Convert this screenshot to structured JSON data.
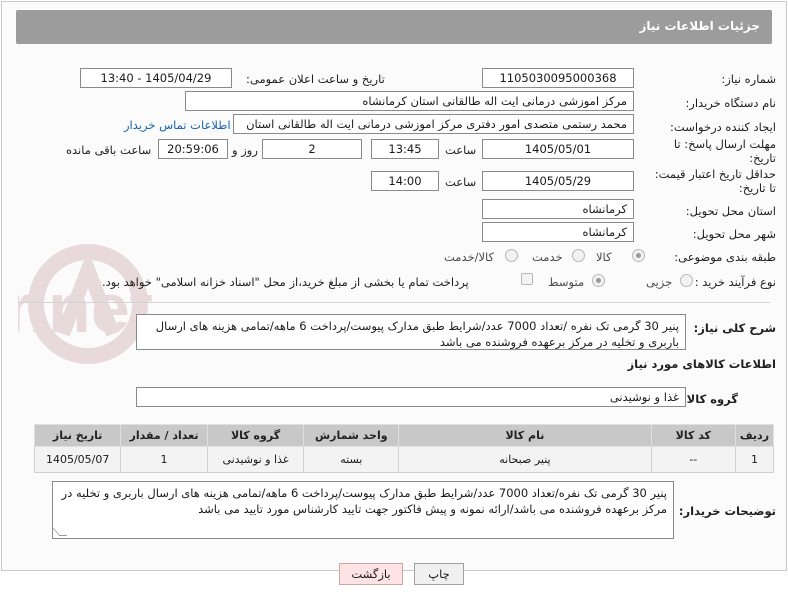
{
  "header": {
    "title": "جزئیات اطلاعات نیاز"
  },
  "form": {
    "need_number": {
      "label": "شماره نیاز:",
      "value": "1105030095000368"
    },
    "announce_datetime": {
      "label": "تاریخ و ساعت اعلان عمومی:",
      "value": "1405/04/29 - 13:40"
    },
    "buyer_org": {
      "label": "نام دستگاه خریدار:",
      "value": "مرکز اموزشی درمانی ایت اله طالقانی استان کرمانشاه"
    },
    "requester": {
      "label": "ایجاد کننده درخواست:",
      "value": "محمد رستمی متصدی امور دفتری مرکز اموزشی درمانی ایت اله طالقانی استان",
      "contact_link": "اطلاعات تماس خریدار"
    },
    "reply_deadline": {
      "label_line1": "مهلت ارسال پاسخ: تا",
      "label_line2": "تاریخ:",
      "date": "1405/05/01",
      "time_label": "ساعت",
      "time": "13:45",
      "days": "2",
      "days_label": "روز و",
      "remaining": "20:59:06",
      "remaining_label": "ساعت باقی مانده"
    },
    "price_validity": {
      "label_line1": "حداقل تاریخ اعتبار قیمت:",
      "label_line2": "تا تاریخ:",
      "date": "1405/05/29",
      "time_label": "ساعت",
      "time": "14:00"
    },
    "delivery_province": {
      "label": "استان محل تحویل:",
      "value": "کرمانشاه"
    },
    "delivery_city": {
      "label": "شهر محل تحویل:",
      "value": "کرمانشاه"
    },
    "category": {
      "label": "طبقه بندی موضوعی:",
      "options": [
        "کالا",
        "خدمت",
        "کالا/خدمت"
      ],
      "selected": "کالا"
    },
    "process_type": {
      "label": "نوع فرآیند خرید :",
      "options": [
        "جزیی",
        "متوسط"
      ],
      "selected": "متوسط",
      "payment_note": "پرداخت تمام یا بخشی از مبلغ خرید،از محل \"اسناد خزانه اسلامی\" خواهد بود."
    }
  },
  "description": {
    "label": "شرح کلی نیاز:",
    "text": "پنیر 30 گرمی تک نفره /تعداد 7000 عدد/شرایط طبق مدارک پیوست/پرداخت 6 ماهه/تمامی هزینه های ارسال باربری و تخلیه در مرکز برعهده فروشنده می باشد"
  },
  "goods": {
    "section_title": "اطلاعات کالاهای مورد نیاز",
    "group_label": "گروه کالا:",
    "group_value": "غذا و نوشیدنی",
    "table": {
      "headers": [
        "ردیف",
        "کد کالا",
        "نام کالا",
        "واحد شمارش",
        "گروه کالا",
        "تعداد / مقدار",
        "تاریخ نیاز"
      ],
      "rows": [
        [
          "1",
          "--",
          "پنیر صبحانه",
          "بسته",
          "غذا و نوشیدنی",
          "1",
          "1405/05/07"
        ]
      ]
    }
  },
  "buyer_notes": {
    "label": "توضیحات خریدار:",
    "text": "پنیر 30 گرمی تک نفره/تعداد 7000 عدد/شرایط طبق مدارک پیوست/پرداخت 6 ماهه/تمامی هزینه های ارسال باربری و تخلیه در مرکز برعهده فروشنده می باشد/ارائه نمونه و پیش فاکتور جهت تایید کارشناس مورد تایید می باشد"
  },
  "buttons": {
    "print": "چاپ",
    "back": "بازگشت"
  },
  "watermark": {
    "text": "AriaTender.net"
  },
  "colors": {
    "header_bg": "#9c9c9c",
    "table_header_bg": "#c8c8c8",
    "link": "#1763b5",
    "back_button_bg": "#fde3e3"
  }
}
